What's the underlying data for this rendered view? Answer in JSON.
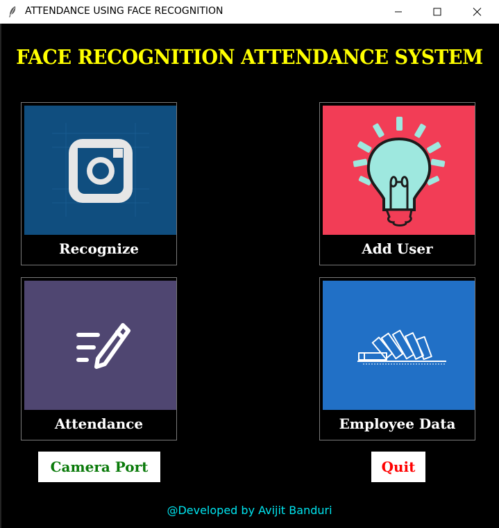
{
  "window": {
    "title": "ATTENDANCE USING FACE RECOGNITION",
    "app_icon": "feather-icon",
    "controls": [
      "minimize-icon",
      "maximize-icon",
      "close-icon"
    ]
  },
  "heading": "FACE RECOGNITION ATTENDANCE SYSTEM",
  "tiles": [
    {
      "label": "Recognize",
      "icon": "camera-icon",
      "color": "#104e7f"
    },
    {
      "label": "Add User",
      "icon": "lightbulb-icon",
      "color": "#f23d56"
    },
    {
      "label": "Attendance",
      "icon": "edit-list-icon",
      "color": "#4f4671"
    },
    {
      "label": "Employee Data",
      "icon": "folders-icon",
      "color": "#2170c6"
    }
  ],
  "buttons": {
    "camera_port": "Camera Port",
    "quit": "Quit"
  },
  "footer": "@Developed by Avijit Banduri",
  "colors": {
    "background": "#000000",
    "heading": "#ffff00",
    "camera_port_text": "#0a7a0a",
    "quit_text": "#ff0000",
    "footer_text": "#00e5f0"
  }
}
